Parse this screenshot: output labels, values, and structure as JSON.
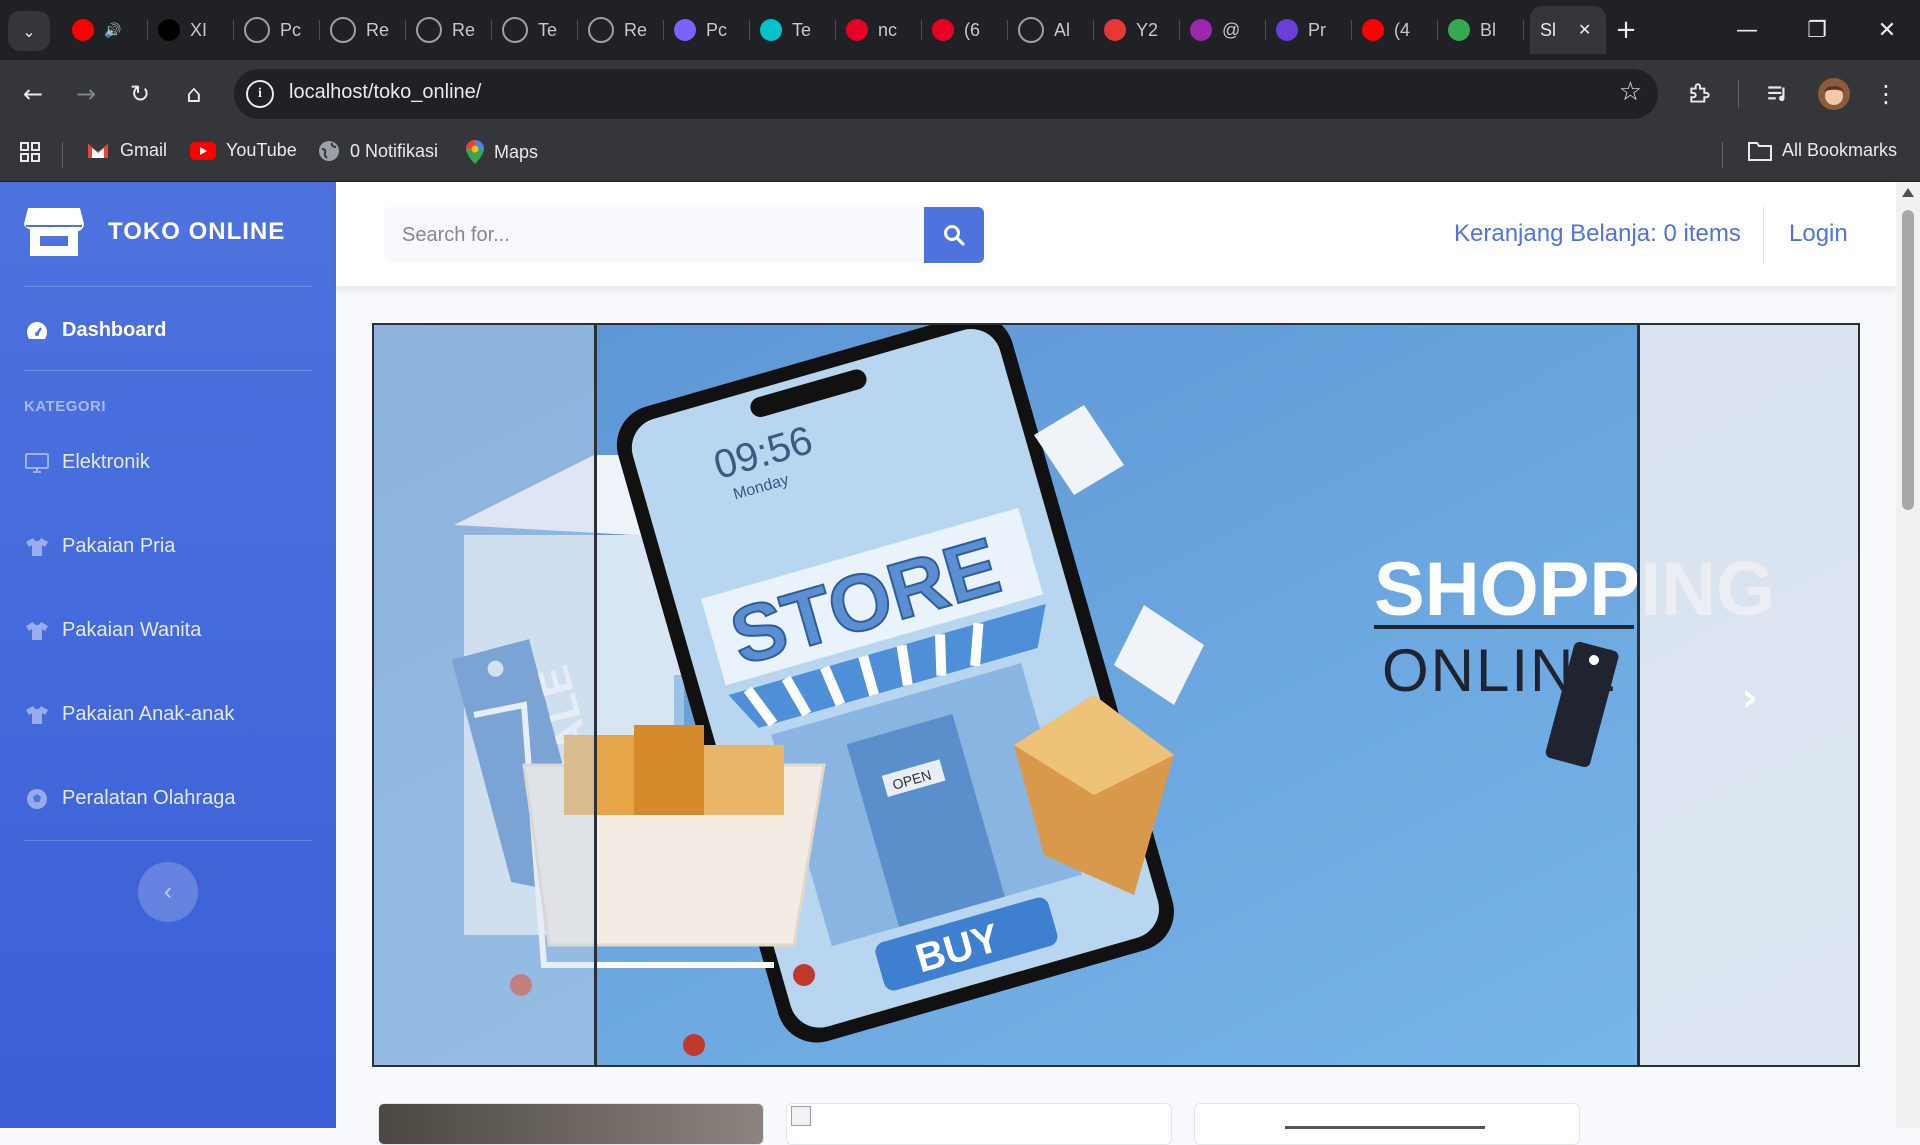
{
  "browser": {
    "tabs": [
      {
        "label": "",
        "icon": "youtube-icon",
        "color": "#ff0000"
      },
      {
        "label": "XI",
        "icon": "m-icon",
        "color": "#000000"
      },
      {
        "label": "Pc",
        "icon": "globe-icon",
        "color": "#5f6368"
      },
      {
        "label": "Re",
        "icon": "globe-icon",
        "color": "#5f6368"
      },
      {
        "label": "Re",
        "icon": "globe-icon",
        "color": "#5f6368"
      },
      {
        "label": "Te",
        "icon": "openai-icon",
        "color": "#ffffff"
      },
      {
        "label": "Re",
        "icon": "openai-icon",
        "color": "#ffffff"
      },
      {
        "label": "Pc",
        "icon": "video-icon",
        "color": "#7b61ff"
      },
      {
        "label": "Te",
        "icon": "canva-icon",
        "color": "#00c4cc"
      },
      {
        "label": "nc",
        "icon": "pinterest-icon",
        "color": "#e60023"
      },
      {
        "label": "(6",
        "icon": "pinterest-icon",
        "color": "#e60023"
      },
      {
        "label": "Al",
        "icon": "globe-icon",
        "color": "#5f6368"
      },
      {
        "label": "Y2",
        "icon": "download-icon",
        "color": "#e53935"
      },
      {
        "label": "@",
        "icon": "send-icon",
        "color": "#9c27b0"
      },
      {
        "label": "Pr",
        "icon": "list-icon",
        "color": "#6a3fd8"
      },
      {
        "label": "(4",
        "icon": "youtube-icon",
        "color": "#ff0000"
      },
      {
        "label": "Bl",
        "icon": "drive-icon",
        "color": "#34a853"
      }
    ],
    "active_tab": {
      "label": "Sl",
      "close": "✕"
    },
    "new_tab": "+",
    "url": "localhost/toko_online/",
    "bookmarks": [
      {
        "label": "Gmail"
      },
      {
        "label": "YouTube"
      },
      {
        "label": "0 Notifikasi"
      },
      {
        "label": "Maps"
      }
    ],
    "all_bookmarks": "All Bookmarks"
  },
  "sidebar": {
    "brand": "TOKO ONLINE",
    "dashboard": "Dashboard",
    "heading": "KATEGORI",
    "categories": [
      {
        "label": "Elektronik",
        "icon": "desktop-icon"
      },
      {
        "label": "Pakaian Pria",
        "icon": "tshirt-icon"
      },
      {
        "label": "Pakaian Wanita",
        "icon": "tshirt-icon"
      },
      {
        "label": "Pakaian Anak-anak",
        "icon": "tshirt-icon"
      },
      {
        "label": "Peralatan Olahraga",
        "icon": "football-icon"
      }
    ]
  },
  "topbar": {
    "search_placeholder": "Search for...",
    "cart": "Keranjang Belanja: 0 items",
    "login": "Login"
  },
  "carousel": {
    "phone_time": "09:56",
    "phone_day": "Monday",
    "store_sign": "STORE",
    "buy": "BUY",
    "sale": "SALE",
    "open": "OPEN",
    "headline_1": "SHOPPING",
    "headline_2": "ONLINE",
    "colors": {
      "background": "#6da2de",
      "accent": "#4e73df"
    }
  }
}
